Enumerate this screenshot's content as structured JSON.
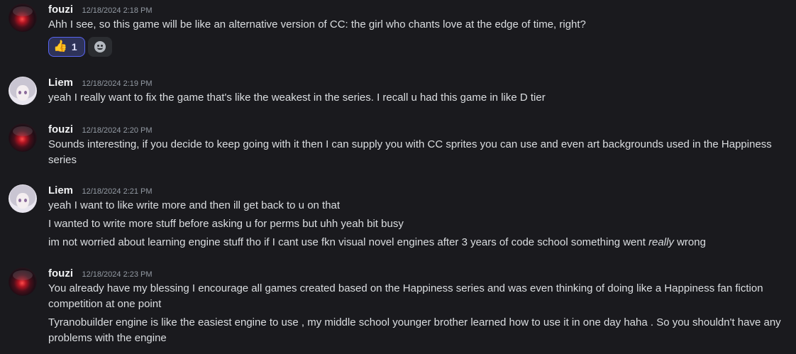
{
  "messages": [
    {
      "username": "fouzi",
      "avatar": "red-eye-avatar",
      "timestamp": "12/18/2024 2:18 PM",
      "lines": [
        "Ahh I see, so this game will be like an alternative version of CC: the girl who chants love at the edge of time, right?"
      ],
      "reactions": [
        {
          "emoji": "thumbs-up-icon",
          "glyph": "👍",
          "count": "1"
        }
      ]
    },
    {
      "username": "Liem",
      "avatar": "white-haired-girl-avatar",
      "timestamp": "12/18/2024 2:19 PM",
      "lines": [
        "yeah I really want to fix the game that's like the weakest in the series. I recall u had this game in like D tier"
      ]
    },
    {
      "username": "fouzi",
      "avatar": "red-eye-avatar",
      "timestamp": "12/18/2024 2:20 PM",
      "lines": [
        "Sounds interesting, if you decide to keep going with it then I can supply you with CC sprites you can use and even art backgrounds used in the Happiness series"
      ]
    },
    {
      "username": "Liem",
      "avatar": "white-haired-girl-avatar",
      "timestamp": "12/18/2024 2:21 PM",
      "lines": [
        "yeah I want to like write more and then ill get back to u on that",
        "I wanted to write more stuff before asking u for perms but uhh yeah bit busy"
      ],
      "line_rich": {
        "before": "im not worried about learning engine stuff tho if I cant use fkn visual novel engines after 3 years of code school something went ",
        "emphasis": "really",
        "after": " wrong"
      }
    },
    {
      "username": "fouzi",
      "avatar": "red-eye-avatar",
      "timestamp": "12/18/2024 2:23 PM",
      "lines": [
        "You already have my blessing I encourage all games created based on the Happiness series and was even thinking of doing like a Happiness fan fiction competition at one point",
        "Tyranobuilder engine is like the easiest engine to use , my middle school younger brother learned how to use it in one day haha . So you shouldn't have any problems with the engine"
      ]
    }
  ],
  "colors": {
    "background": "#1a1a1e",
    "text": "#dbdee1",
    "username": "#f2f3f5",
    "timestamp": "#949ba4",
    "reaction_active_border": "#5865f2",
    "reaction_active_bg": "#2e3359"
  }
}
